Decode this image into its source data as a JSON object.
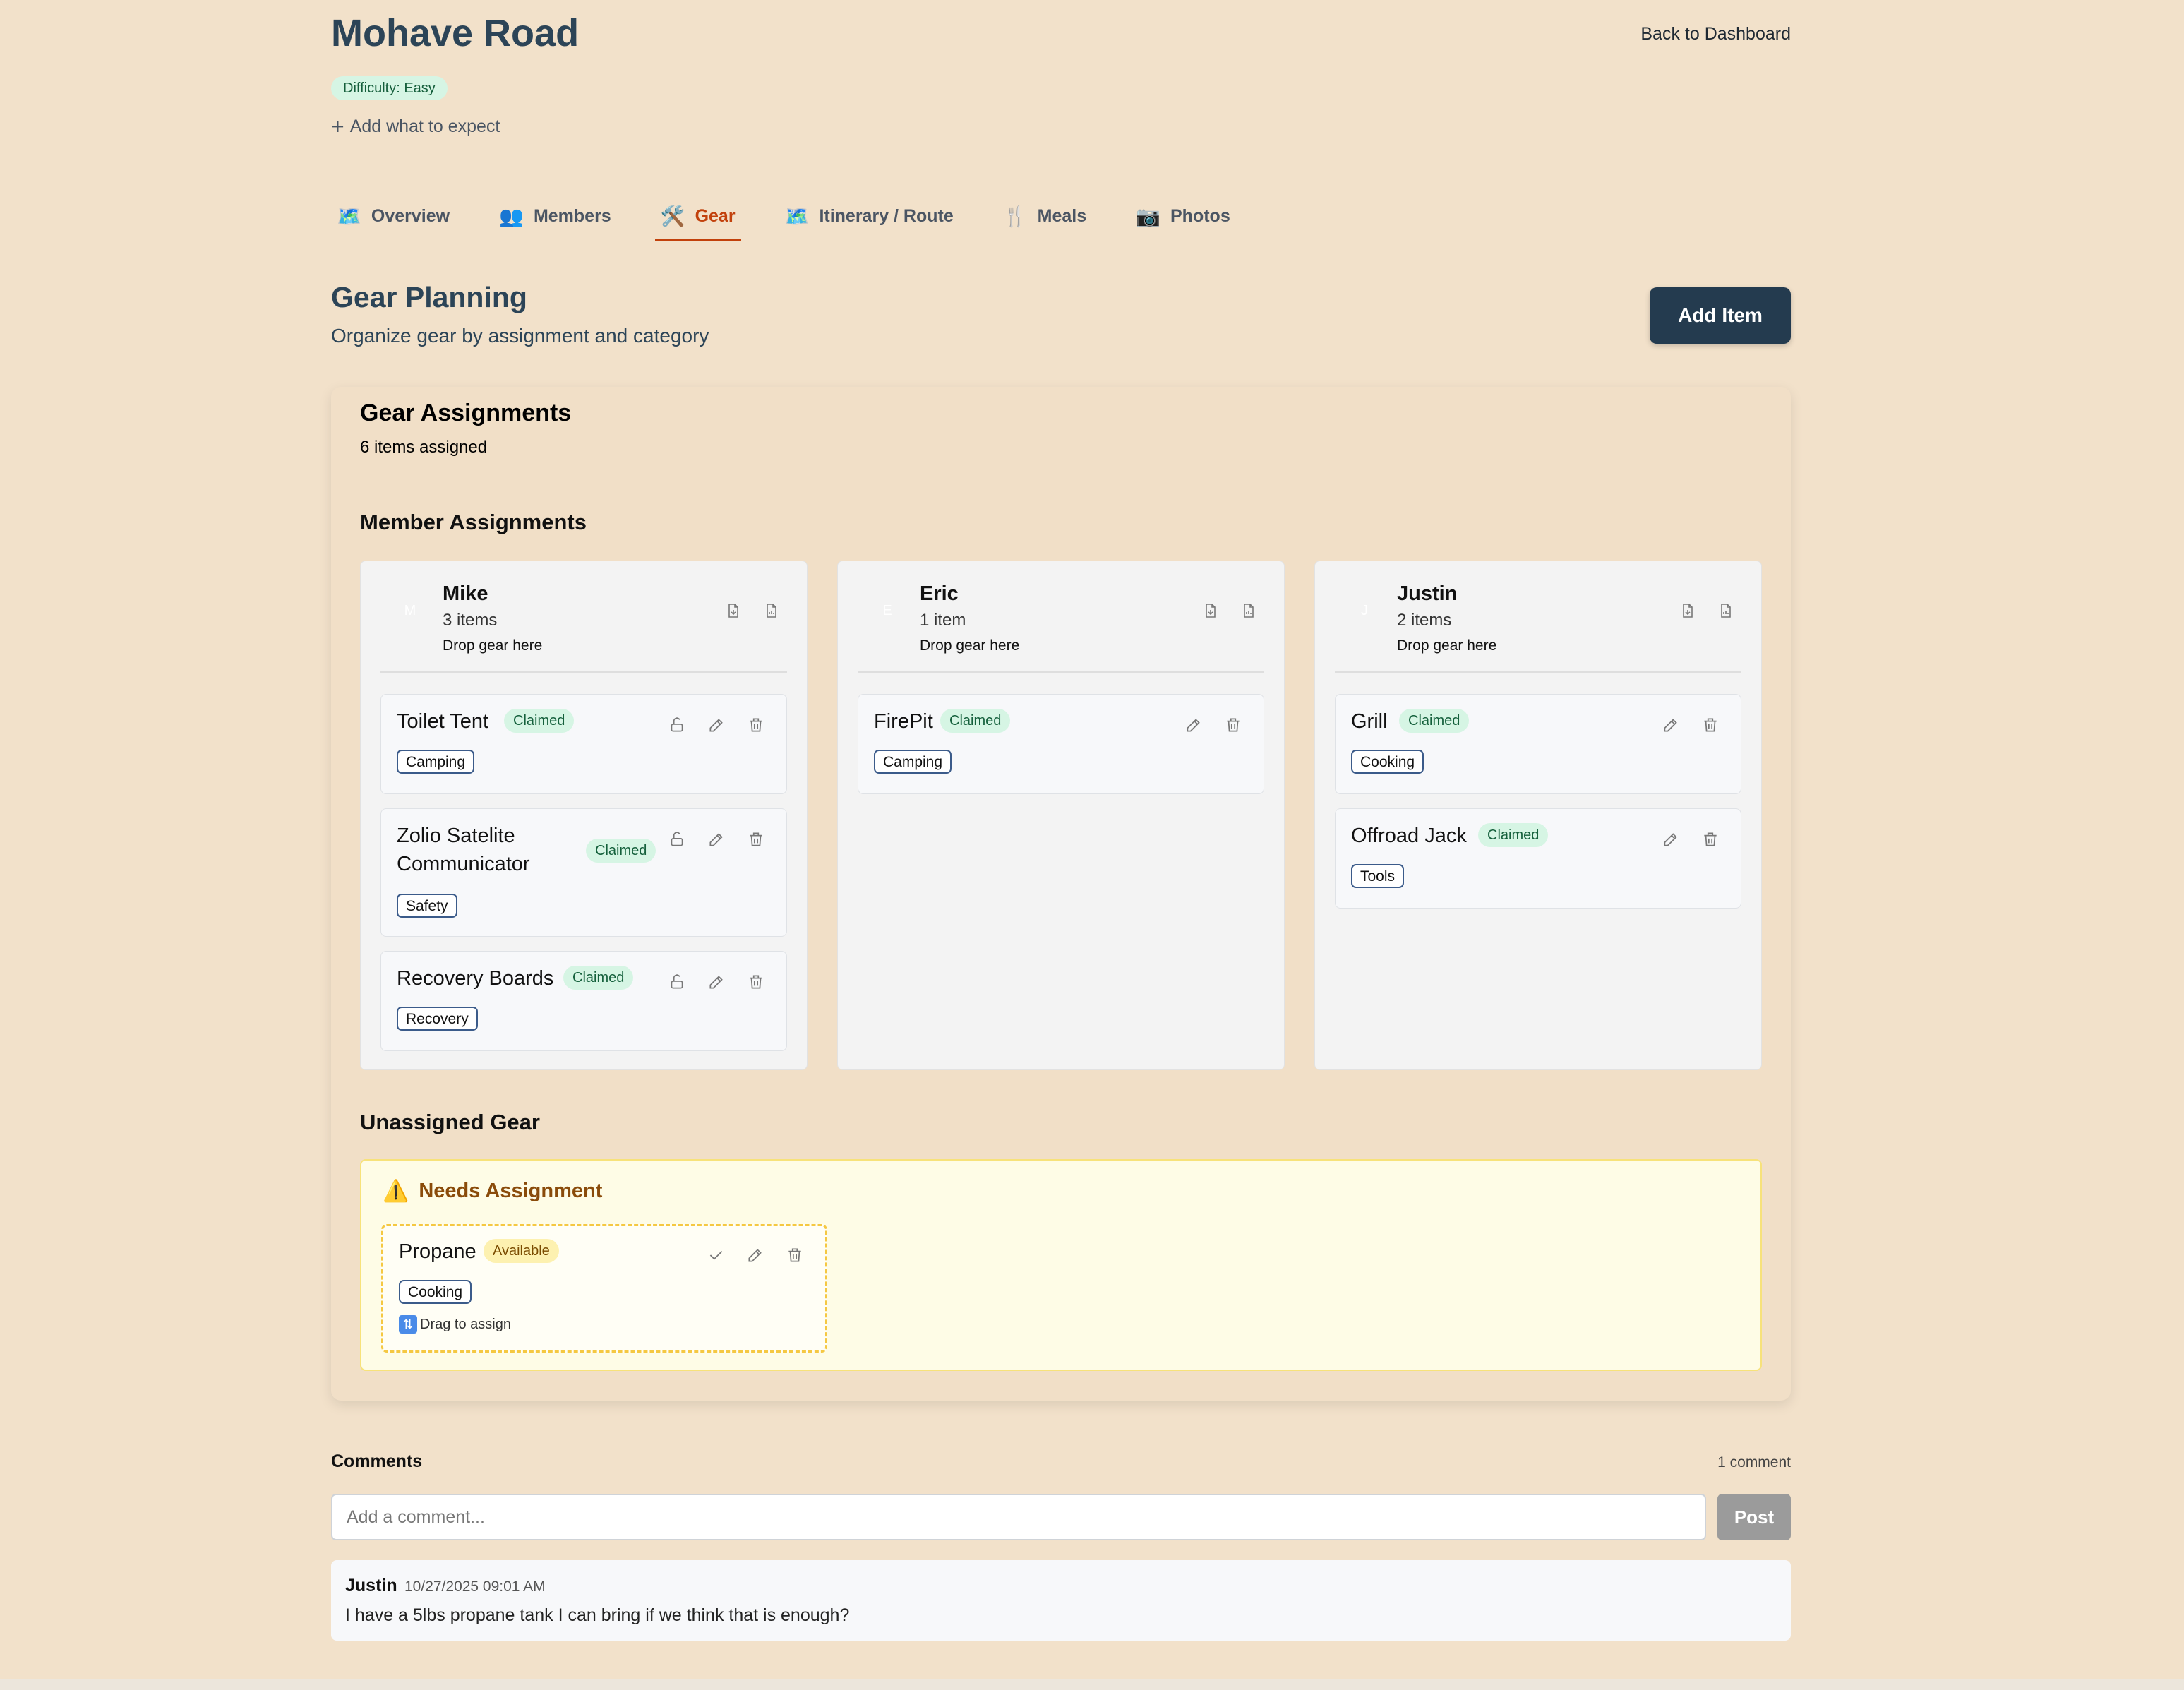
{
  "trip": {
    "title": "Mohave Road",
    "back_label": "Back to Dashboard",
    "difficulty": "Difficulty: Easy",
    "add_expect": "Add what to expect"
  },
  "tabs": [
    {
      "label": "Overview",
      "icon": "🗺️",
      "active": false
    },
    {
      "label": "Members",
      "icon": "👥",
      "active": false
    },
    {
      "label": "Gear",
      "icon": "🛠️",
      "active": true
    },
    {
      "label": "Itinerary / Route",
      "icon": "🗺️",
      "active": false
    },
    {
      "label": "Meals",
      "icon": "🍴",
      "active": false
    },
    {
      "label": "Photos",
      "icon": "📷",
      "active": false
    }
  ],
  "gear": {
    "title": "Gear Planning",
    "subtitle": "Organize gear by assignment and category",
    "add_item_label": "Add Item",
    "assignments_title": "Gear Assignments",
    "assignments_count": "6 items assigned",
    "member_heading": "Member Assignments",
    "drop_hint": "Drop gear here",
    "members": [
      {
        "name": "Mike",
        "initial": "M",
        "count": "3 items",
        "items": [
          {
            "name": "Toilet Tent",
            "status": "Claimed",
            "category": "Camping"
          },
          {
            "name": "Zolio Satelite Communicator",
            "status": "Claimed",
            "category": "Safety"
          },
          {
            "name": "Recovery Boards",
            "status": "Claimed",
            "category": "Recovery"
          }
        ]
      },
      {
        "name": "Eric",
        "initial": "E",
        "count": "1 item",
        "items": [
          {
            "name": "FirePit",
            "status": "Claimed",
            "category": "Camping"
          }
        ]
      },
      {
        "name": "Justin",
        "initial": "J",
        "count": "2 items",
        "items": [
          {
            "name": "Grill",
            "status": "Claimed",
            "category": "Cooking"
          },
          {
            "name": "Offroad Jack",
            "status": "Claimed",
            "category": "Tools"
          }
        ]
      }
    ],
    "unassigned_heading": "Unassigned Gear",
    "needs_title": "Needs Assignment",
    "unassigned": [
      {
        "name": "Propane",
        "status": "Available",
        "category": "Cooking",
        "hint": "Drag to assign"
      }
    ]
  },
  "comments": {
    "label": "Comments",
    "count": "1 comment",
    "placeholder": "Add a comment...",
    "post_label": "Post",
    "items": [
      {
        "author": "Justin",
        "time": "10/27/2025 09:01 AM",
        "text": "I have a 5lbs propane tank I can bring if we think that is enough?"
      }
    ]
  },
  "colors": {
    "background": "#f2e1ca",
    "accent": "#c2410c",
    "heading": "#2c4457",
    "primary_button": "#243b4f",
    "claimed_badge": "#d6f5e4",
    "available_badge": "#fdf1b0"
  }
}
